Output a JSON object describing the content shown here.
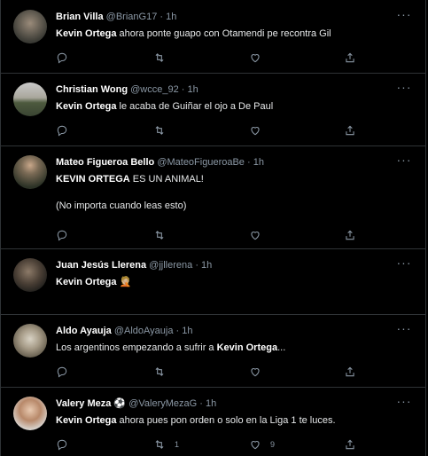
{
  "colors": {
    "background": "#000000",
    "muted": "#8b98a5",
    "text": "#e7e9ea",
    "divider": "#2f3336"
  },
  "more_icon": "more-dots-icon",
  "tweets": [
    {
      "name": "Brian Villa",
      "handle": "@BrianG17",
      "time": "1h",
      "mention": "Kevin Ortega",
      "text_rest": " ahora ponte guapo con Otamendi pe recontra Gil",
      "avatar_icon": "avatar"
    },
    {
      "name": "Christian Wong",
      "handle": "@wcce_92",
      "time": "1h",
      "mention": "Kevin Ortega",
      "text_rest": " le acaba de Guiñar el ojo a De Paul",
      "avatar_icon": "avatar"
    },
    {
      "name": "Mateo Figueroa Bello",
      "handle": "@MateoFigueroaBe",
      "time": "1h",
      "mention": "KEVIN ORTEGA",
      "text_rest": " ES UN ANIMAL!",
      "text_line2": "(No importa cuando leas esto)",
      "avatar_icon": "avatar"
    },
    {
      "name": "Juan Jesús Llerena",
      "handle": "@jjllerena",
      "time": "1h",
      "mention": "Kevin Ortega",
      "text_rest": " 🤦🏼",
      "avatar_icon": "avatar"
    },
    {
      "name": "Aldo Ayauja",
      "handle": "@AldoAyauja",
      "time": "1h",
      "text_pre": "Los argentinos empezando a sufrir a ",
      "mention": "Kevin Ortega",
      "text_rest": "...",
      "avatar_icon": "avatar"
    },
    {
      "name": "Valery Meza ⚽",
      "handle": "@ValeryMezaG",
      "time": "1h",
      "mention": "Kevin Ortega",
      "text_rest": " ahora pues pon orden o solo en la Liga 1 te luces.",
      "retweets": "1",
      "likes": "9",
      "avatar_icon": "avatar"
    }
  ],
  "action_icons": [
    "reply-icon",
    "retweet-icon",
    "like-icon",
    "share-icon"
  ],
  "separator": "·"
}
